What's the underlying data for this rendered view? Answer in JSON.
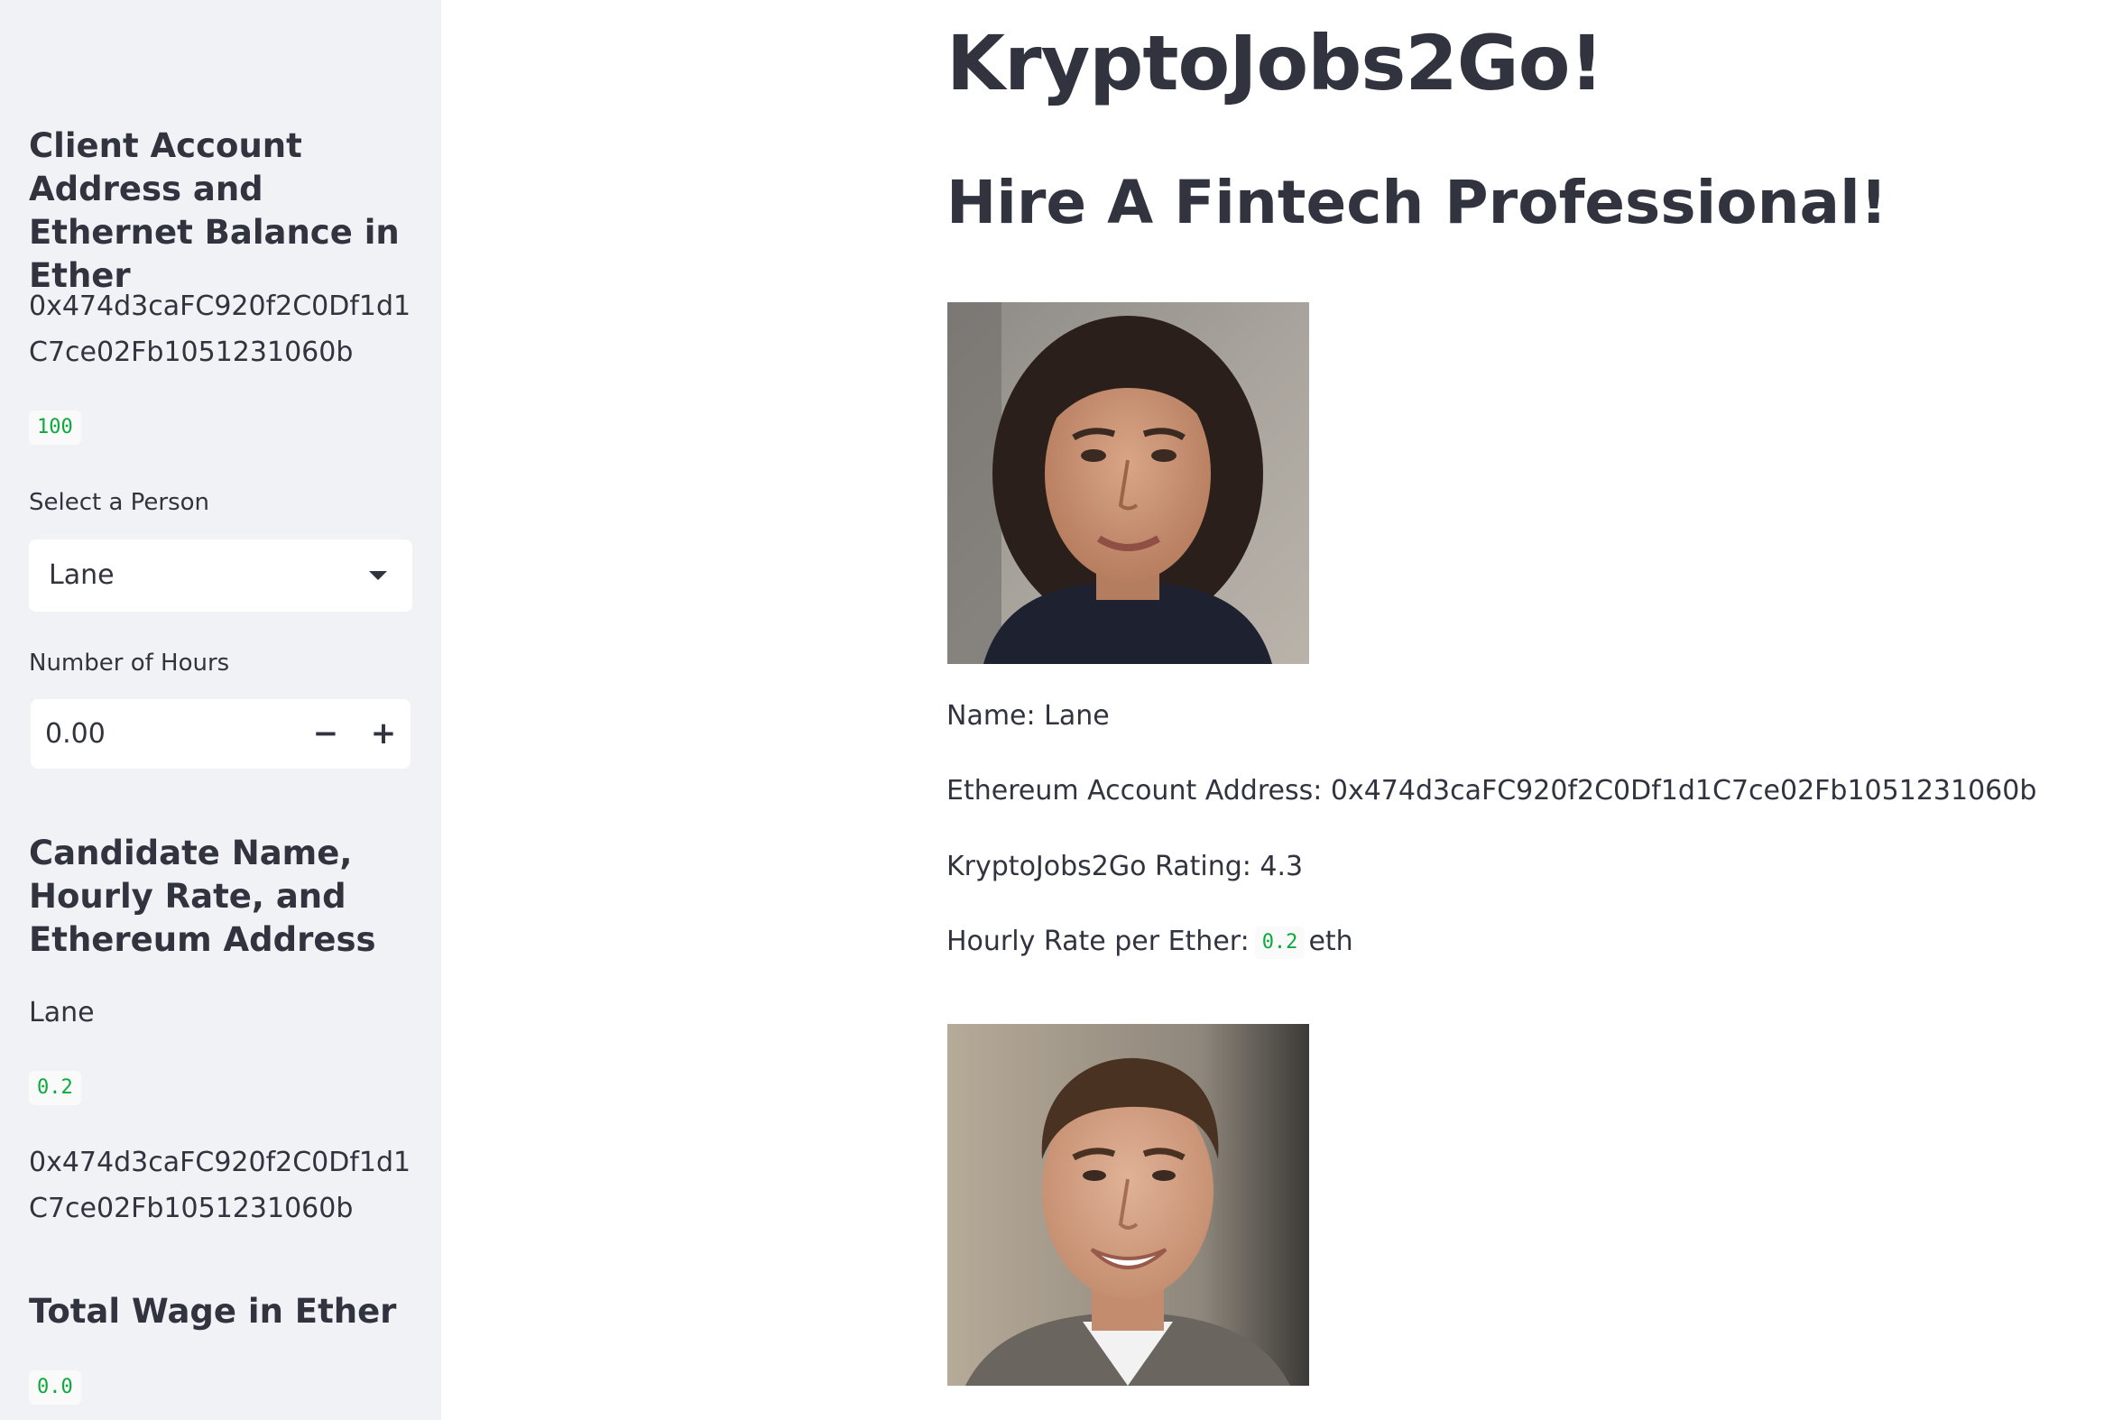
{
  "sidebar": {
    "account_heading": "Client Account Address and Ethernet Balance in Ether",
    "account_address": "0x474d3caFC920f2C0Df1d1C7ce02Fb1051231060b",
    "balance": "100",
    "select_label": "Select a Person",
    "selected_person": "Lane",
    "hours_label": "Number of Hours",
    "hours_value": "0.00",
    "decrement_symbol": "−",
    "increment_symbol": "+",
    "candidate_heading": "Candidate Name, Hourly Rate, and Ethereum Address",
    "candidate_name": "Lane",
    "candidate_rate": "0.2",
    "candidate_address": "0x474d3caFC920f2C0Df1d1C7ce02Fb1051231060b",
    "wage_heading": "Total Wage in Ether",
    "wage_value": "0.0"
  },
  "main": {
    "title": "KryptoJobs2Go!",
    "subtitle": "Hire A Fintech Professional!",
    "candidates": [
      {
        "name_line": "Name: Lane",
        "address_line": "Ethereum Account Address: 0x474d3caFC920f2C0Df1d1C7ce02Fb1051231060b",
        "rating_line": "KryptoJobs2Go Rating: 4.3",
        "rate_prefix": "Hourly Rate per Ether:",
        "rate_value": "0.2",
        "rate_suffix": "eth"
      }
    ]
  },
  "colors": {
    "sidebar_bg": "#f0f2f6",
    "text": "#31333f",
    "code_green": "#09ab3b"
  }
}
